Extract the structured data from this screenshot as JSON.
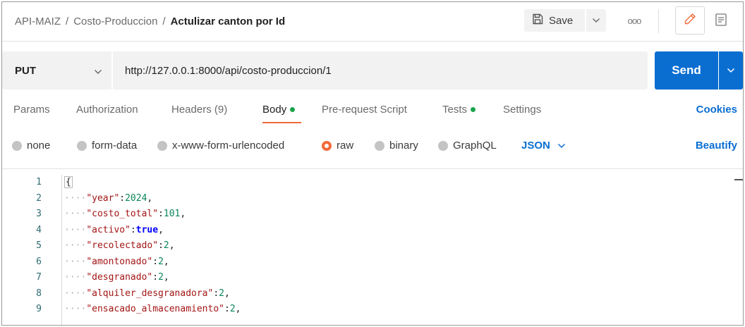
{
  "header": {
    "breadcrumb": [
      "API-MAIZ",
      "Costo-Produccion"
    ],
    "separator": "/",
    "current": "Actulizar canton por Id",
    "save_label": "Save",
    "more_label": "ooo"
  },
  "request": {
    "method": "PUT",
    "url": "http://127.0.0.1:8000/api/costo-produccion/1",
    "send_label": "Send"
  },
  "tabs": [
    {
      "label": "Params"
    },
    {
      "label": "Authorization"
    },
    {
      "label": "Headers (9)"
    },
    {
      "label": "Body"
    },
    {
      "label": "Pre-request Script"
    },
    {
      "label": "Tests"
    },
    {
      "label": "Settings"
    }
  ],
  "active_tab": "Body",
  "cookies_label": "Cookies",
  "body_types": [
    {
      "label": "none"
    },
    {
      "label": "form-data"
    },
    {
      "label": "x-www-form-urlencoded"
    },
    {
      "label": "raw"
    },
    {
      "label": "binary"
    },
    {
      "label": "GraphQL"
    }
  ],
  "selected_body_type": "raw",
  "format_label": "JSON",
  "beautify_label": "Beautify",
  "editor": {
    "line_numbers": [
      "1",
      "2",
      "3",
      "4",
      "5",
      "6",
      "7",
      "8",
      "9"
    ],
    "open_brace": "{",
    "indent": "····",
    "lines": [
      {
        "key": "\"year\"",
        "value": "2024",
        "type": "number"
      },
      {
        "key": "\"costo_total\"",
        "value": "101",
        "type": "number"
      },
      {
        "key": "\"activo\"",
        "value": "true",
        "type": "keyword"
      },
      {
        "key": "\"recolectado\"",
        "value": "2",
        "type": "number"
      },
      {
        "key": "\"amontonado\"",
        "value": "2",
        "type": "number"
      },
      {
        "key": "\"desgranado\"",
        "value": "2",
        "type": "number"
      },
      {
        "key": "\"alquiler_desgranadora\"",
        "value": "2",
        "type": "number"
      },
      {
        "key": "\"ensacado_almacenamiento\"",
        "value": "2",
        "type": "number"
      }
    ]
  },
  "colors": {
    "accent": "#0a6ed1",
    "active_tab": "#f26b3a",
    "status_dot": "#1aa34a",
    "json_key": "#a31515",
    "json_number": "#098658"
  }
}
